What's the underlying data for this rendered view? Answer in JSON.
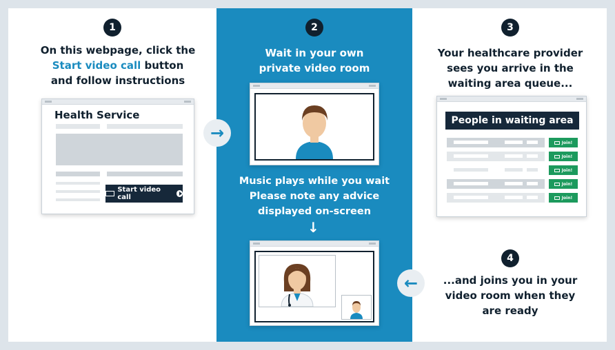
{
  "steps": [
    {
      "number": "1",
      "lines": [
        "On this webpage, click the",
        "Start video call",
        "button",
        "and follow instructions"
      ],
      "window": {
        "title": "Health Service",
        "button_label": "Start video call"
      }
    },
    {
      "number": "2",
      "lines": [
        "Wait in your own",
        "private video room"
      ],
      "middle_lines": [
        "Music plays while you wait",
        "Please note any advice",
        "displayed on-screen"
      ]
    },
    {
      "number": "3",
      "lines": [
        "Your healthcare provider",
        "sees you arrive in the",
        "waiting area queue..."
      ],
      "window": {
        "header": "People in waiting area",
        "join_label": "Join!",
        "rows": 5
      }
    },
    {
      "number": "4",
      "lines": [
        "...and joins you in your",
        "video room when they",
        "are ready"
      ]
    }
  ],
  "arrows": {
    "right": "→",
    "down": "↓",
    "left": "←"
  },
  "icons": [
    "video-camera-icon",
    "play-icon",
    "patient-avatar",
    "doctor-avatar",
    "right-arrow-icon",
    "left-arrow-icon",
    "down-arrow-icon"
  ],
  "colors": {
    "accent": "#1a8bbf",
    "dark": "#10202e",
    "join_green": "#1c9a5d",
    "background": "#dde4ea"
  }
}
